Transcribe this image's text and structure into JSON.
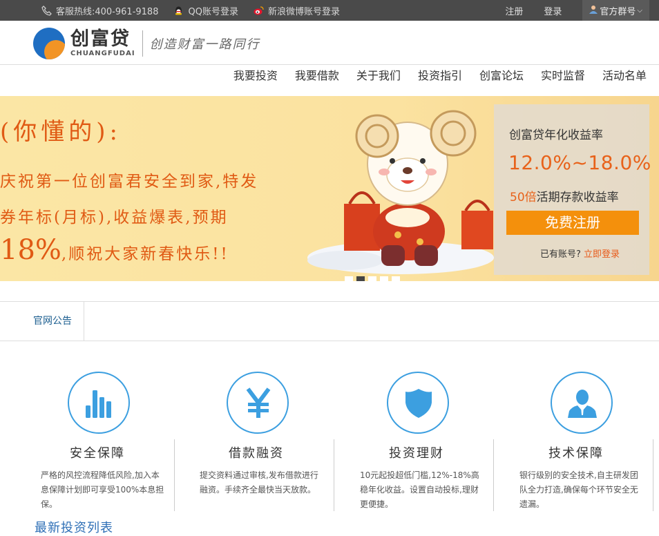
{
  "topbar": {
    "hotline": "客服热线:400-961-9188",
    "qq_login": "QQ账号登录",
    "weibo_login": "新浪微博账号登录",
    "register": "注册",
    "login": "登录",
    "group": "官方群号"
  },
  "header": {
    "logo_cn": "创富贷",
    "logo_en": "CHUANGFUDAI",
    "slogan": "创造财富一路同行"
  },
  "nav": {
    "items": [
      "我要投资",
      "我要借款",
      "关于我们",
      "投资指引",
      "创富论坛",
      "实时监督",
      "活动名单"
    ]
  },
  "banner": {
    "line1": "(你懂的):",
    "line2": "庆祝第一位创富君安全到家,特发",
    "line3": "券年标(月标),收益爆表,预期",
    "line4_big": "18%",
    "line4_small": ",顺祝大家新春快乐!!",
    "slides": 5,
    "active_slide": 2
  },
  "signup": {
    "title": "创富贷年化收益率",
    "rate": "12.0%~18.0%",
    "multiple": "50倍",
    "multiple_text": "活期存款收益率",
    "button": "免费注册",
    "have_account": "已有账号?",
    "login_now": "立即登录"
  },
  "notice": {
    "label": "官网公告"
  },
  "features": [
    {
      "icon": "bar-chart-icon",
      "title": "安全保障",
      "desc": "严格的风控流程降低风险,加入本息保障计划即可享受100%本息担保。"
    },
    {
      "icon": "yen-icon",
      "title": "借款融资",
      "desc": "提交资料通过审核,发布借款进行融资。手续齐全最快当天放款。"
    },
    {
      "icon": "shield-icon",
      "title": "投资理财",
      "desc": "10元起投超低门槛,12%-18%高稳年化收益。设置自动投标,理财更便捷。"
    },
    {
      "icon": "user-icon",
      "title": "技术保障",
      "desc": "银行级别的安全技术,自主研发团队全力打造,确保每个环节安全无遗漏。"
    }
  ],
  "latest": {
    "title": "最新投资列表"
  },
  "colors": {
    "accent_orange": "#f4900c",
    "accent_blue": "#3c9fe0",
    "topbar": "#4a4a4a"
  }
}
